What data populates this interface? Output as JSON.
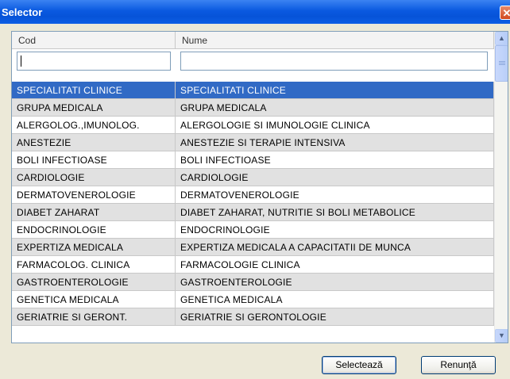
{
  "window": {
    "title": "Selector"
  },
  "grid": {
    "columns": [
      {
        "label": "Cod"
      },
      {
        "label": "Nume"
      }
    ],
    "filters": {
      "cod": "",
      "nume": ""
    },
    "selected_index": 0,
    "rows": [
      {
        "cod": "SPECIALITATI CLINICE",
        "nume": "SPECIALITATI CLINICE"
      },
      {
        "cod": "GRUPA MEDICALA",
        "nume": "GRUPA MEDICALA"
      },
      {
        "cod": "ALERGOLOG.,IMUNOLOG.",
        "nume": "ALERGOLOGIE SI IMUNOLOGIE CLINICA"
      },
      {
        "cod": "ANESTEZIE",
        "nume": "ANESTEZIE SI TERAPIE INTENSIVA"
      },
      {
        "cod": "BOLI INFECTIOASE",
        "nume": "BOLI INFECTIOASE"
      },
      {
        "cod": "CARDIOLOGIE",
        "nume": "CARDIOLOGIE"
      },
      {
        "cod": "DERMATOVENEROLOGIE",
        "nume": "DERMATOVENEROLOGIE"
      },
      {
        "cod": "DIABET ZAHARAT",
        "nume": "DIABET ZAHARAT, NUTRITIE SI BOLI METABOLICE"
      },
      {
        "cod": "ENDOCRINOLOGIE",
        "nume": "ENDOCRINOLOGIE"
      },
      {
        "cod": "EXPERTIZA MEDICALA",
        "nume": "EXPERTIZA MEDICALA A CAPACITATII DE MUNCA"
      },
      {
        "cod": "FARMACOLOG. CLINICA",
        "nume": "FARMACOLOGIE CLINICA"
      },
      {
        "cod": "GASTROENTEROLOGIE",
        "nume": "GASTROENTEROLOGIE"
      },
      {
        "cod": "GENETICA MEDICALA",
        "nume": "GENETICA MEDICALA"
      },
      {
        "cod": "GERIATRIE SI GERONT.",
        "nume": "GERIATRIE SI GERONTOLOGIE"
      }
    ]
  },
  "buttons": {
    "select_label": "Selectează",
    "cancel_label": "Renunţă"
  },
  "icons": {
    "close": "close-icon",
    "scroll_up": "scroll-up-icon",
    "scroll_down": "scroll-down-icon"
  },
  "colors": {
    "selection": "#316ac5",
    "title_bar": "#0a59e0",
    "alt_row": "#e1e1e1"
  }
}
